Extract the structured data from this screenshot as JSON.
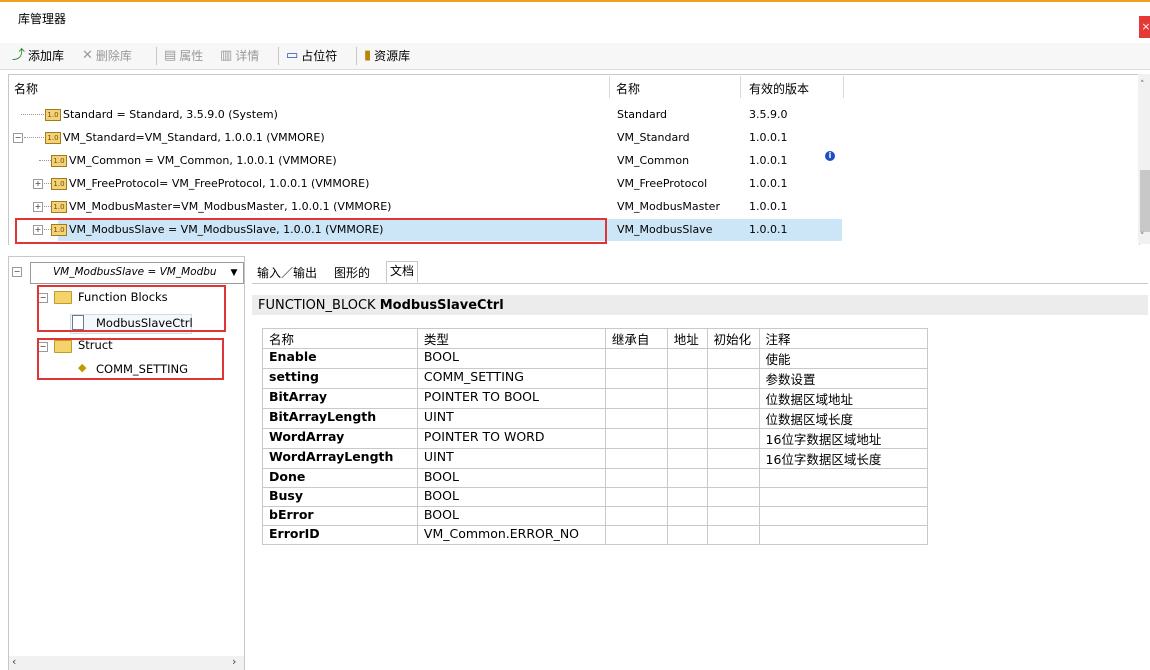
{
  "window": {
    "title": "库管理器",
    "close_glyph": "×"
  },
  "toolbar": {
    "add_library": "添加库",
    "delete_library": "删除库",
    "properties": "属性",
    "details": "详情",
    "placeholder": "占位符",
    "library_repository": "资源库"
  },
  "libraries": {
    "headers": {
      "name": "名称",
      "name2": "名称",
      "effective_version": "有效的版本"
    },
    "rows": [
      {
        "tree": "Standard = Standard, 3.5.9.0 (System)",
        "name": "Standard",
        "version": "3.5.9.0"
      },
      {
        "tree": "VM_Standard=VM_Standard, 1.0.0.1 (VMMORE)",
        "name": "VM_Standard",
        "version": "1.0.0.1"
      },
      {
        "tree": "VM_Common = VM_Common, 1.0.0.1 (VMMORE)",
        "name": "VM_Common",
        "version": "1.0.0.1",
        "info_icon": "i"
      },
      {
        "tree": "VM_FreeProtocol= VM_FreeProtocol, 1.0.0.1 (VMMORE)",
        "name": "VM_FreeProtocol",
        "version": "1.0.0.1"
      },
      {
        "tree": "VM_ModbusMaster=VM_ModbusMaster, 1.0.0.1 (VMMORE)",
        "name": "VM_ModbusMaster",
        "version": "1.0.0.1"
      },
      {
        "tree": "VM_ModbusSlave = VM_ModbusSlave, 1.0.0.1 (VMMORE)",
        "name": "VM_ModbusSlave",
        "version": "1.0.0.1"
      }
    ],
    "icon_label": "1.0"
  },
  "left_panel": {
    "selector": "VM_ModbusSlave = VM_Modbu",
    "function_blocks": "Function Blocks",
    "modbus_slave_ctrl": "ModbusSlaveCtrl",
    "struct": "Struct",
    "comm_setting": "COMM_SETTING"
  },
  "tabs": {
    "io": "输入／输出",
    "graphic": "图形的",
    "doc": "文档"
  },
  "doc": {
    "fb_keyword": "FUNCTION_BLOCK",
    "fb_name": "ModbusSlaveCtrl",
    "columns": [
      "名称",
      "类型",
      "继承自",
      "地址",
      "初始化",
      "注释"
    ],
    "params": [
      {
        "name": "Enable",
        "type": "BOOL",
        "comment": "使能"
      },
      {
        "name": "setting",
        "type": "COMM_SETTING",
        "comment": "参数设置"
      },
      {
        "name": "BitArray",
        "type": "POINTER TO BOOL",
        "comment": "位数据区域地址"
      },
      {
        "name": "BitArrayLength",
        "type": "UINT",
        "comment": "位数据区域长度"
      },
      {
        "name": "WordArray",
        "type": "POINTER TO WORD",
        "comment": "16位字数据区域地址"
      },
      {
        "name": "WordArrayLength",
        "type": "UINT",
        "comment": "16位字数据区域长度"
      },
      {
        "name": "Done",
        "type": "BOOL",
        "comment": ""
      },
      {
        "name": "Busy",
        "type": "BOOL",
        "comment": ""
      },
      {
        "name": "bError",
        "type": "BOOL",
        "comment": ""
      },
      {
        "name": "ErrorID",
        "type": "VM_Common.ERROR_NO",
        "comment": ""
      }
    ]
  },
  "colors": {
    "selection": "#cde6f7",
    "highlight_box": "#e03535",
    "title_accent": "#f0a020"
  }
}
